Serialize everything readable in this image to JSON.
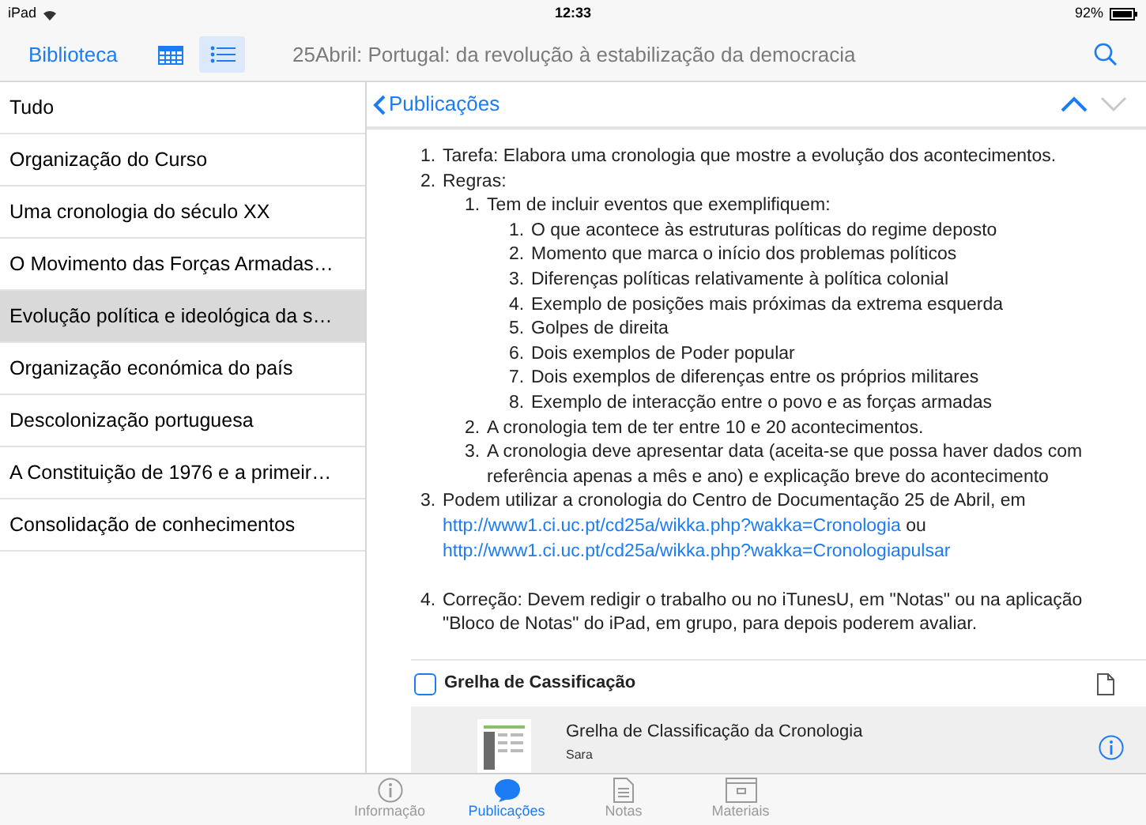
{
  "status_bar": {
    "device": "iPad",
    "time": "12:33",
    "battery": "92%"
  },
  "toolbar": {
    "back_label": "Biblioteca",
    "views": [
      {
        "kind": "calendar",
        "selected": false
      },
      {
        "kind": "list",
        "selected": true
      }
    ],
    "title": "25Abril: Portugal: da revolução à estabilização da democracia"
  },
  "sidebar": {
    "items": [
      {
        "label": "Tudo",
        "selected": false
      },
      {
        "label": "Organização do Curso",
        "selected": false
      },
      {
        "label": "Uma cronologia do século XX",
        "selected": false
      },
      {
        "label": "O Movimento das Forças Armadas…",
        "selected": false
      },
      {
        "label": "Evolução política e ideológica da s…",
        "selected": true
      },
      {
        "label": "Organização económica do país",
        "selected": false
      },
      {
        "label": "Descolonização portuguesa",
        "selected": false
      },
      {
        "label": "A Constituição de 1976 e a primeir…",
        "selected": false
      },
      {
        "label": "Consolidação de conhecimentos",
        "selected": false
      }
    ]
  },
  "detail": {
    "back_label": "Publicações",
    "body": [
      {
        "number": "1.",
        "segments": [
          {
            "kind": "text",
            "text": "Tarefa: Elabora uma cronologia que mostre a evolução dos acontecimentos."
          }
        ]
      },
      {
        "number": "2.",
        "segments": [
          {
            "kind": "text",
            "text": "Regras:"
          }
        ],
        "children": [
          {
            "number": "1.",
            "segments": [
              {
                "kind": "text",
                "text": "Tem de incluir eventos que exemplifiquem:"
              }
            ],
            "children": [
              {
                "number": "1.",
                "segments": [
                  {
                    "kind": "text",
                    "text": "O que acontece às estruturas políticas do regime deposto"
                  }
                ]
              },
              {
                "number": "2.",
                "segments": [
                  {
                    "kind": "text",
                    "text": "Momento que marca o início dos problemas políticos"
                  }
                ]
              },
              {
                "number": "3.",
                "segments": [
                  {
                    "kind": "text",
                    "text": "Diferenças políticas relativamente à política colonial"
                  }
                ]
              },
              {
                "number": "4.",
                "segments": [
                  {
                    "kind": "text",
                    "text": "Exemplo de posições mais próximas da extrema esquerda"
                  }
                ]
              },
              {
                "number": "5.",
                "segments": [
                  {
                    "kind": "text",
                    "text": "Golpes de direita"
                  }
                ]
              },
              {
                "number": "6.",
                "segments": [
                  {
                    "kind": "text",
                    "text": "Dois exemplos de Poder popular"
                  }
                ]
              },
              {
                "number": "7.",
                "segments": [
                  {
                    "kind": "text",
                    "text": "Dois exemplos de diferenças entre os próprios militares"
                  }
                ]
              },
              {
                "number": "8.",
                "segments": [
                  {
                    "kind": "text",
                    "text": "Exemplo de interacção entre o povo e as forças armadas"
                  }
                ]
              }
            ]
          },
          {
            "number": "2.",
            "segments": [
              {
                "kind": "text",
                "text": "A cronologia tem de ter entre 10 e 20 acontecimentos."
              }
            ]
          },
          {
            "number": "3.",
            "segments": [
              {
                "kind": "text",
                "text": "A cronologia deve apresentar data (aceita-se que possa haver dados com referência apenas a mês e ano) e explicação breve do acontecimento"
              }
            ]
          }
        ]
      },
      {
        "number": "3.",
        "segments": [
          {
            "kind": "text",
            "text": "Podem utilizar a cronologia do Centro de Documentação 25 de Abril, em"
          },
          {
            "kind": "link",
            "text": "http://www1.ci.uc.pt/cd25a/wikka.php?wakka=Cronologia"
          },
          {
            "kind": "text",
            "text": "ou"
          },
          {
            "kind": "link",
            "text": "http://www1.ci.uc.pt/cd25a/wikka.php?wakka=Cronologiapulsar"
          }
        ]
      },
      {
        "number": "4.",
        "spaced": true,
        "segments": [
          {
            "kind": "text",
            "text": "Correção: Devem redigir o trabalho ou no iTunesU, em \"Notas\" ou na aplicação \"Bloco de Notas\" do iPad, em grupo, para depois poderem avaliar."
          }
        ]
      }
    ],
    "attachment": {
      "title": "Grelha de Cassificação",
      "checked": false,
      "file": {
        "title": "Grelha de Classificação da Cronologia",
        "author": "Sara"
      }
    }
  },
  "tab_bar": [
    {
      "kind": "info",
      "label": "Informação",
      "selected": false
    },
    {
      "kind": "chat",
      "label": "Publicações",
      "selected": true
    },
    {
      "kind": "note",
      "label": "Notas",
      "selected": false
    },
    {
      "kind": "box",
      "label": "Materiais",
      "selected": false
    }
  ]
}
